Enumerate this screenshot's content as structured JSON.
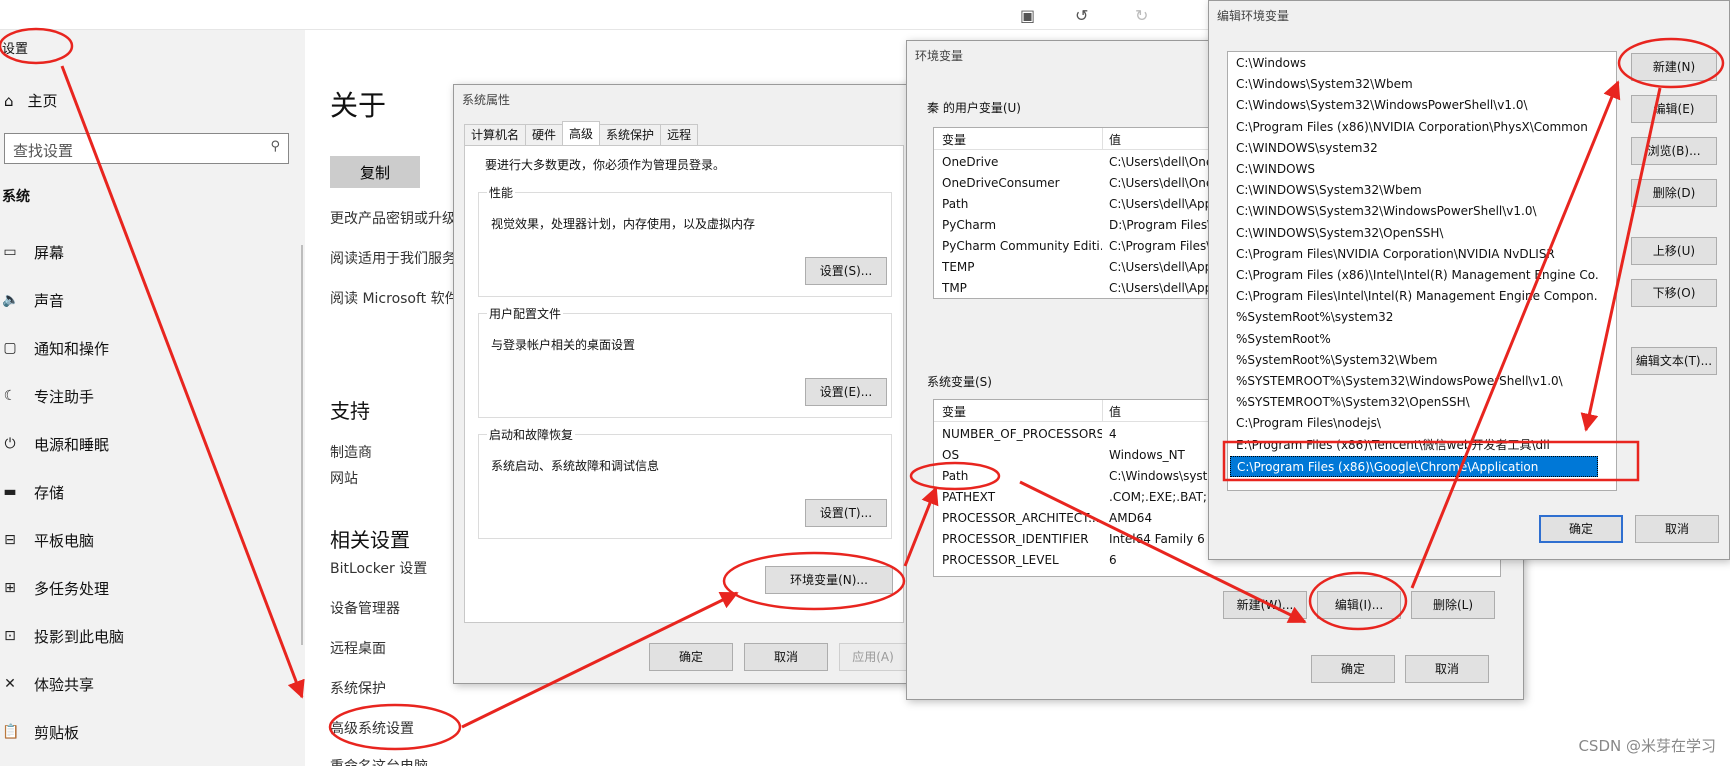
{
  "settings": {
    "title": "设置",
    "home": "主页",
    "search_placeholder": "查找设置",
    "section": "系统",
    "nav": [
      {
        "icon": "monitor-icon",
        "glyph": "▭",
        "label": "屏幕"
      },
      {
        "icon": "speaker-icon",
        "glyph": "🔈",
        "label": "声音"
      },
      {
        "icon": "message-icon",
        "glyph": "▢",
        "label": "通知和操作"
      },
      {
        "icon": "moon-icon",
        "glyph": "☾",
        "label": "专注助手"
      },
      {
        "icon": "power-icon",
        "glyph": "⏻",
        "label": "电源和睡眠"
      },
      {
        "icon": "storage-icon",
        "glyph": "▬",
        "label": "存储"
      },
      {
        "icon": "tablet-icon",
        "glyph": "⊟",
        "label": "平板电脑"
      },
      {
        "icon": "multitask-icon",
        "glyph": "⊞",
        "label": "多任务处理"
      },
      {
        "icon": "project-icon",
        "glyph": "⊡",
        "label": "投影到此电脑"
      },
      {
        "icon": "share-icon",
        "glyph": "✕",
        "label": "体验共享"
      },
      {
        "icon": "clipboard-icon",
        "glyph": "📋",
        "label": "剪贴板"
      }
    ],
    "about_title": "关于",
    "copy_label": "复制",
    "links": [
      "更改产品密钥或升级",
      "阅读适用于我们服务",
      "阅读 Microsoft 软件"
    ],
    "support_head": "支持",
    "support_links": [
      "制造商",
      "网站"
    ],
    "related_head": "相关设置",
    "related_links": [
      "BitLocker 设置",
      "设备管理器",
      "远程桌面",
      "系统保护",
      "高级系统设置",
      "重命名这台电脑"
    ]
  },
  "sysprop": {
    "title": "系统属性",
    "tabs": [
      "计算机名",
      "硬件",
      "高级",
      "系统保护",
      "远程"
    ],
    "notice": "要进行大多数更改，你必须作为管理员登录。",
    "groups": [
      {
        "title": "性能",
        "desc": "视觉效果，处理器计划，内存使用，以及虚拟内存",
        "button": "设置(S)..."
      },
      {
        "title": "用户配置文件",
        "desc": "与登录帐户相关的桌面设置",
        "button": "设置(E)..."
      },
      {
        "title": "启动和故障恢复",
        "desc": "系统启动、系统故障和调试信息",
        "button": "设置(T)..."
      }
    ],
    "env_button": "环境变量(N)...",
    "ok": "确定",
    "cancel": "取消",
    "apply": "应用(A)"
  },
  "envvars": {
    "title": "环境变量",
    "user_label": "秦 的用户变量(U)",
    "col_var": "变量",
    "col_val": "值",
    "user_vars": [
      {
        "name": "OneDrive",
        "value": "C:\\Users\\dell\\One"
      },
      {
        "name": "OneDriveConsumer",
        "value": "C:\\Users\\dell\\One"
      },
      {
        "name": "Path",
        "value": "C:\\Users\\dell\\App"
      },
      {
        "name": "PyCharm",
        "value": "D:\\Program Files\\"
      },
      {
        "name": "PyCharm Community Editi...",
        "value": "C:\\Program Files\\"
      },
      {
        "name": "TEMP",
        "value": "C:\\Users\\dell\\App"
      },
      {
        "name": "TMP",
        "value": "C:\\Users\\dell\\App"
      }
    ],
    "sys_label": "系统变量(S)",
    "sys_vars": [
      {
        "name": "NUMBER_OF_PROCESSORS",
        "value": "4"
      },
      {
        "name": "OS",
        "value": "Windows_NT"
      },
      {
        "name": "Path",
        "value": "C:\\Windows\\syste"
      },
      {
        "name": "PATHEXT",
        "value": ".COM;.EXE;.BAT;.C"
      },
      {
        "name": "PROCESSOR_ARCHITECT...",
        "value": "AMD64"
      },
      {
        "name": "PROCESSOR_IDENTIFIER",
        "value": "Intel64 Family 6 M"
      },
      {
        "name": "PROCESSOR_LEVEL",
        "value": "6"
      }
    ],
    "new_btn": "新建(W)...",
    "edit_btn": "编辑(I)...",
    "delete_btn": "删除(L)",
    "ok": "确定",
    "cancel": "取消"
  },
  "editenv": {
    "title": "编辑环境变量",
    "entries": [
      "C:\\Windows",
      "C:\\Windows\\System32\\Wbem",
      "C:\\Windows\\System32\\WindowsPowerShell\\v1.0\\",
      "C:\\Program Files (x86)\\NVIDIA Corporation\\PhysX\\Common",
      "C:\\WINDOWS\\system32",
      "C:\\WINDOWS",
      "C:\\WINDOWS\\System32\\Wbem",
      "C:\\WINDOWS\\System32\\WindowsPowerShell\\v1.0\\",
      "C:\\WINDOWS\\System32\\OpenSSH\\",
      "C:\\Program Files\\NVIDIA Corporation\\NVIDIA NvDLISR",
      "C:\\Program Files (x86)\\Intel\\Intel(R) Management Engine Co...",
      "C:\\Program Files\\Intel\\Intel(R) Management Engine Compon...",
      "%SystemRoot%\\system32",
      "%SystemRoot%",
      "%SystemRoot%\\System32\\Wbem",
      "%SYSTEMROOT%\\System32\\WindowsPowerShell\\v1.0\\",
      "%SYSTEMROOT%\\System32\\OpenSSH\\",
      "C:\\Program Files\\nodejs\\",
      "E:\\Program Files (x86)\\Tencent\\微信web开发者工具\\dll",
      "C:\\Program Files (x86)\\Google\\Chrome\\Application"
    ],
    "selected_index": 19,
    "buttons": [
      "新建(N)",
      "编辑(E)",
      "浏览(B)...",
      "删除(D)",
      "上移(U)",
      "下移(O)",
      "编辑文本(T)..."
    ],
    "ok": "确定",
    "cancel": "取消"
  },
  "watermark": "CSDN @米芽在学习",
  "colors": {
    "annotation": "#e8251f",
    "selection": "#0078d7"
  }
}
